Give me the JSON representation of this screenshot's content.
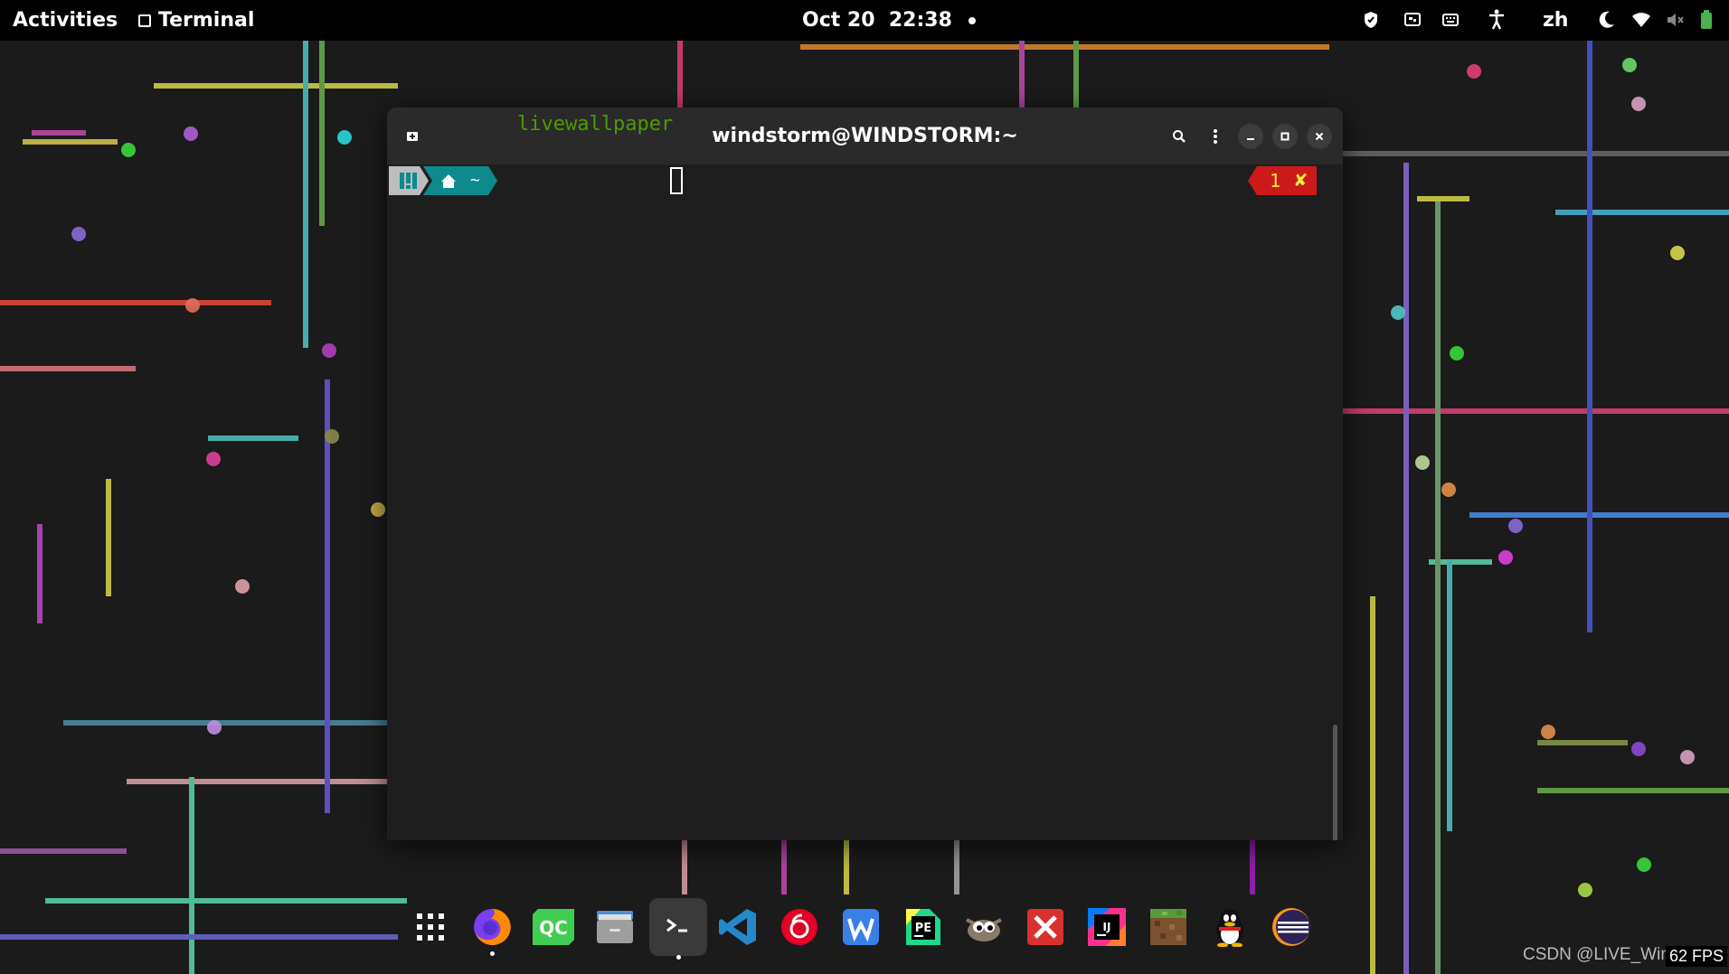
{
  "topbar": {
    "activities": "Activities",
    "app_name": "Terminal",
    "date": "Oct 20",
    "time": "22:38",
    "language": "zh",
    "icons": [
      "shield-icon",
      "screen-icon",
      "keyboard-icon",
      "accessibility-icon",
      "night-light-icon",
      "wifi-icon",
      "volume-muted-icon",
      "battery-icon"
    ]
  },
  "terminal": {
    "title": "windstorm@WINDSTORM:~",
    "prompt_dir": "~",
    "command": "livewallpaper",
    "exit_code": "1",
    "exit_mark": "✘"
  },
  "dock": {
    "apps": [
      "app-grid",
      "firefox",
      "qt-creator",
      "files",
      "terminal",
      "vscode",
      "netease-music",
      "wps-writer",
      "pycharm-edu",
      "gimp",
      "xmind",
      "intellij-idea",
      "minecraft",
      "qq",
      "eclipse"
    ],
    "active": "terminal"
  },
  "watermark": "CSDN @LIVE_Windstorm",
  "fps": "62 FPS",
  "colors": {
    "prompt_os": "#bdbdbd",
    "prompt_home": "#0e8a8f",
    "command_green": "#4e9a06",
    "status_red": "#cc1a1a",
    "status_yellow": "#ffeb3b"
  }
}
